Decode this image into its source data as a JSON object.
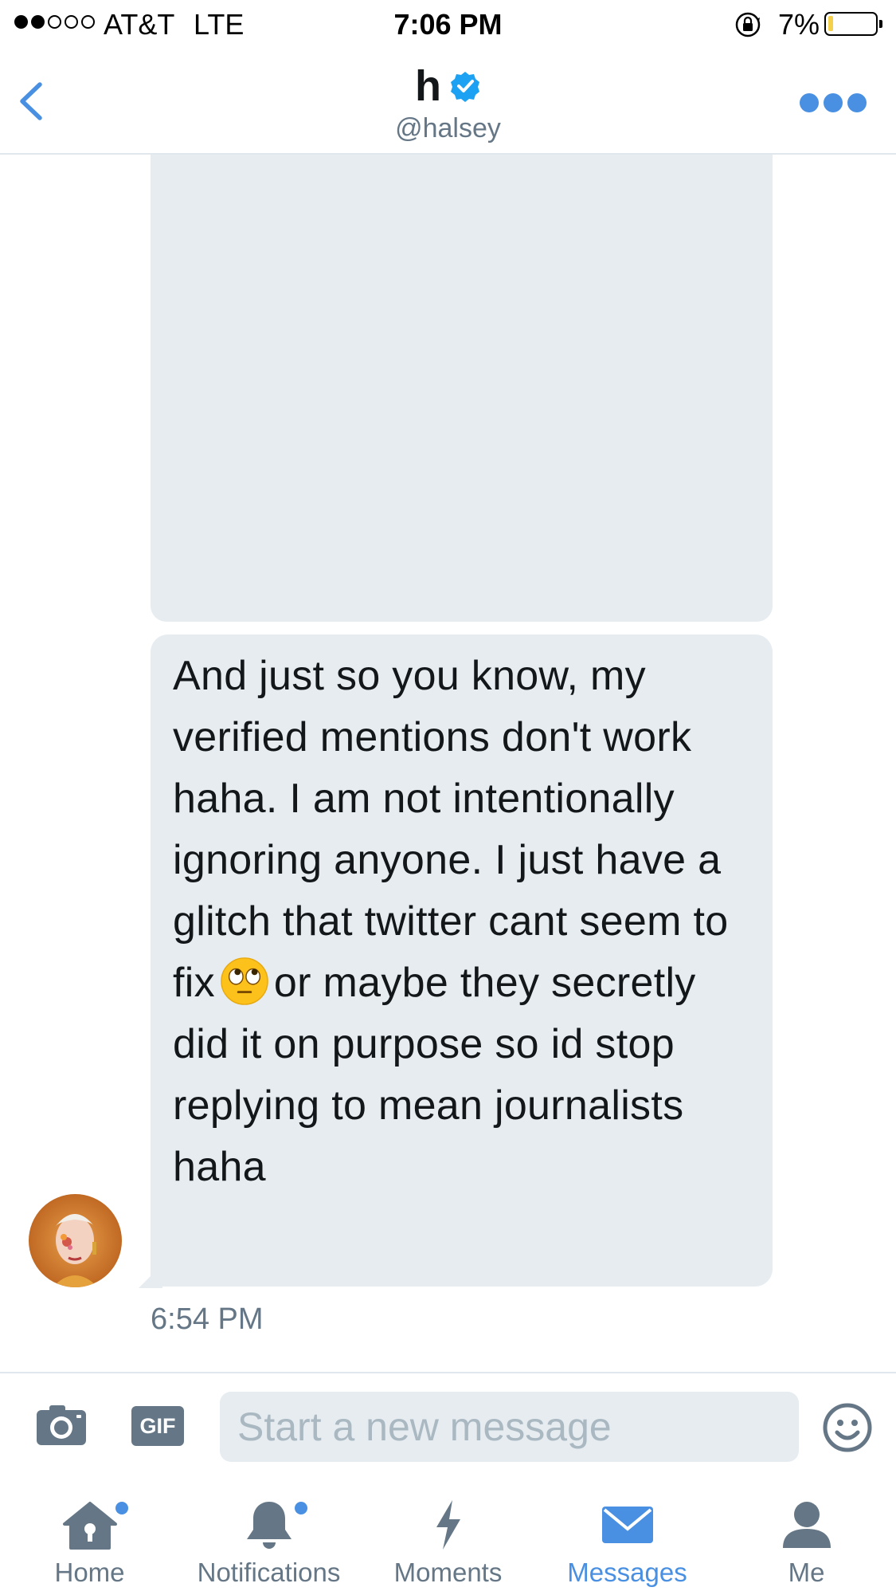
{
  "status_bar": {
    "carrier": "AT&T",
    "network": "LTE",
    "time": "7:06 PM",
    "battery_percent": "7%",
    "battery_level": 0.07,
    "signal_bars_filled": 2,
    "signal_bars_total": 5
  },
  "header": {
    "display_name": "h",
    "handle": "@halsey",
    "verified": true,
    "back_icon": "chevron-left-icon",
    "more_icon": "more-dots-icon"
  },
  "conversation": {
    "message": {
      "text_before_emoji": "And just so you know, my verified mentions don't work haha. I am not intentionally ignoring anyone. I just have a glitch that twitter cant seem to fix",
      "emoji": "face-with-rolling-eyes",
      "text_after_emoji": "or maybe they secretly did it on purpose so id stop replying to mean journalists haha",
      "timestamp": "6:54 PM"
    }
  },
  "composer": {
    "placeholder": "Start a new message",
    "value": "",
    "gif_label": "GIF",
    "camera_icon": "camera-icon",
    "emoji_icon": "smiley-icon"
  },
  "tab_bar": {
    "tabs": [
      {
        "label": "Home",
        "icon": "home-icon",
        "badge": true,
        "active": false
      },
      {
        "label": "Notifications",
        "icon": "bell-icon",
        "badge": true,
        "active": false
      },
      {
        "label": "Moments",
        "icon": "lightning-icon",
        "badge": false,
        "active": false
      },
      {
        "label": "Messages",
        "icon": "envelope-icon",
        "badge": false,
        "active": true
      },
      {
        "label": "Me",
        "icon": "person-icon",
        "badge": false,
        "active": false
      }
    ]
  },
  "colors": {
    "accent": "#4a90e2",
    "bubble": "#e6ecf0",
    "secondary_text": "#657786",
    "verified": "#1da1f2"
  }
}
